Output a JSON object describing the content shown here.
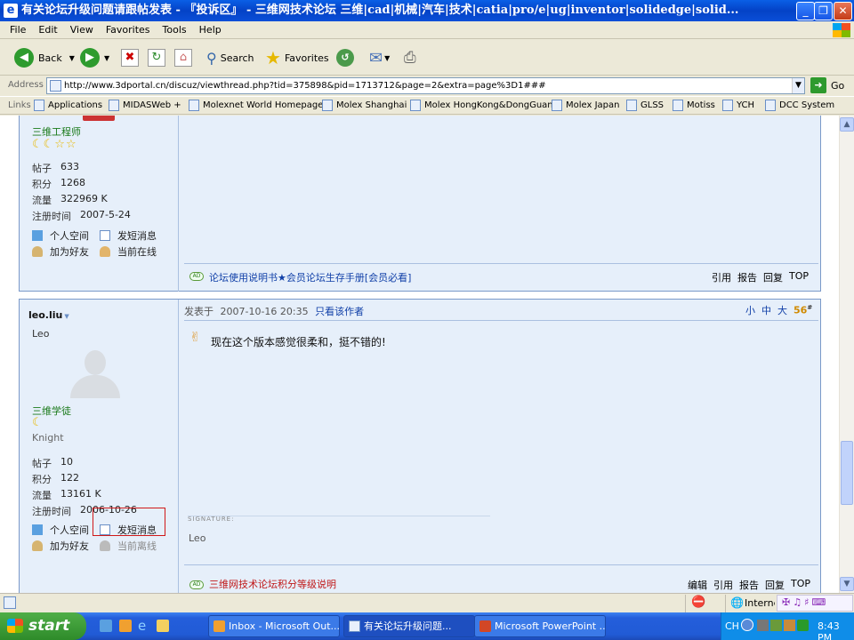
{
  "window": {
    "title": "有关论坛升级问题请跟帖发表 - 『投诉区』 - 三维网技术论坛 三维|cad|机械|汽车|技术|catia|pro/e|ug|inventor|solidedge|solid...",
    "minimize": "_",
    "maximize": "❐",
    "close": "✕"
  },
  "menu": [
    "File",
    "Edit",
    "View",
    "Favorites",
    "Tools",
    "Help"
  ],
  "toolbar": {
    "back": "Back",
    "search": "Search",
    "favorites": "Favorites"
  },
  "address": {
    "label": "Address",
    "url": "http://www.3dportal.cn/discuz/viewthread.php?tid=375898&pid=1713712&page=2&extra=page%3D1###",
    "go": "Go"
  },
  "links": {
    "label": "Links",
    "items": [
      "Applications",
      "MIDASWeb +",
      "Molexnet World Homepage",
      "Molex Shanghai",
      "Molex HongKong&DongGuan",
      "Molex Japan",
      "GLSS",
      "Motiss",
      "YCH",
      "DCC System"
    ]
  },
  "post1": {
    "rank": "三维工程师",
    "stats": [
      {
        "label": "帖子",
        "value": "633"
      },
      {
        "label": "积分",
        "value": "1268"
      },
      {
        "label": "流量",
        "value": "322969 K"
      },
      {
        "label": "注册时间",
        "value": "2007-5-24"
      }
    ],
    "actions": {
      "space": "个人空间",
      "pm": "发短消息",
      "friend": "加为好友",
      "online": "当前在线"
    },
    "ad_badge": "AD",
    "ad_link": "论坛使用说明书★会员论坛生存手册[会员必看]",
    "footer": [
      "引用",
      "报告",
      "回复",
      "TOP"
    ]
  },
  "post2": {
    "username": "leo.liu",
    "nickname": "Leo",
    "rank": "三维学徒",
    "title": "Knight",
    "posted_label": "发表于",
    "posted_time": "2007-10-16 20:35",
    "only_author": "只看该作者",
    "font_sizes": [
      "小",
      "中",
      "大"
    ],
    "floor": "56",
    "floor_mark": "#",
    "message": "现在这个版本感觉很柔和，挺不错的!",
    "signature_label": "SIGNATURE:",
    "signature": "Leo",
    "stats": [
      {
        "label": "帖子",
        "value": "10"
      },
      {
        "label": "积分",
        "value": "122"
      },
      {
        "label": "流量",
        "value": "13161 K"
      },
      {
        "label": "注册时间",
        "value": "2006-10-26"
      }
    ],
    "actions": {
      "space": "个人空间",
      "pm": "发短消息",
      "friend": "加为好友",
      "offline": "当前离线"
    },
    "ad_badge": "AD",
    "ad_link": "三维网技术论坛积分等级说明",
    "footer": [
      "编辑",
      "引用",
      "报告",
      "回复",
      "TOP"
    ]
  },
  "statusbar": {
    "zone": "Interne"
  },
  "taskbar": {
    "start": "start",
    "tasks": [
      "Inbox - Microsoft Out...",
      "有关论坛升级问题...",
      "Microsoft PowerPoint ..."
    ],
    "lang": "CH",
    "clock": "8:43 PM"
  }
}
